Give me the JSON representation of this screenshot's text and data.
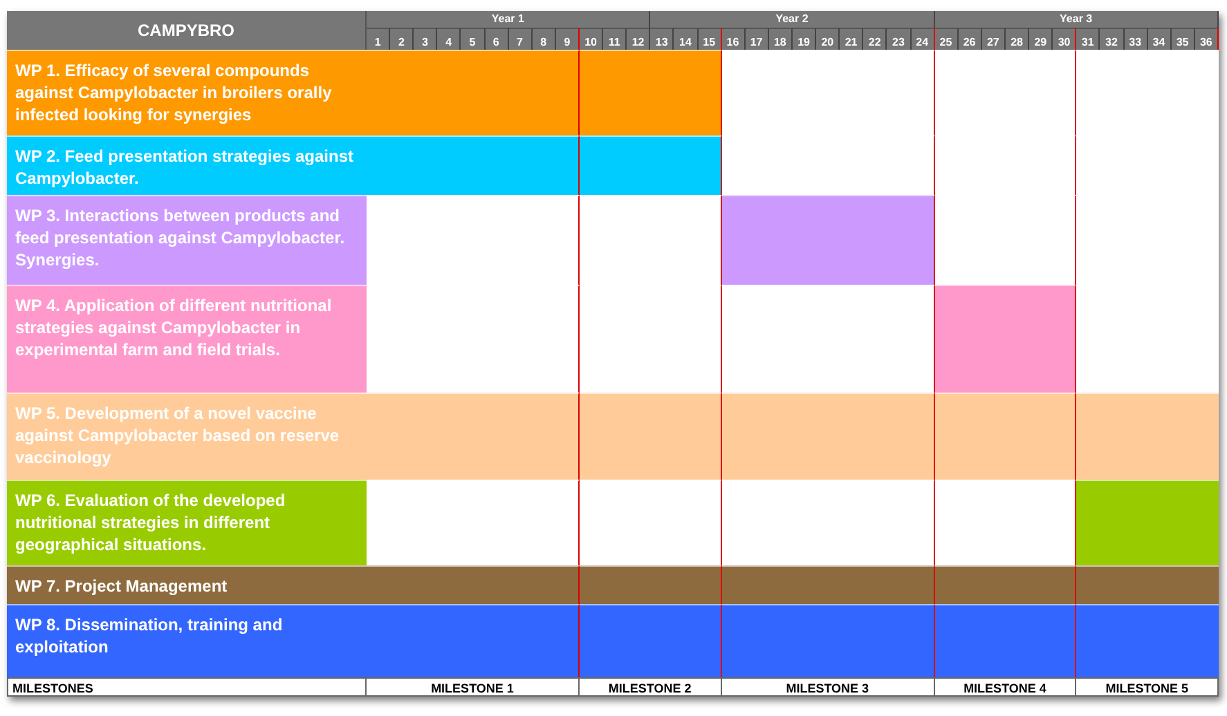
{
  "title": "CAMPYBRO",
  "years": [
    {
      "label": "Year 1",
      "months": [
        {
          "label": "1",
          "milestone_end": false
        },
        {
          "label": "2",
          "milestone_end": false
        },
        {
          "label": "3",
          "milestone_end": false
        },
        {
          "label": "4",
          "milestone_end": false
        },
        {
          "label": "5",
          "milestone_end": false
        },
        {
          "label": "6",
          "milestone_end": false
        },
        {
          "label": "7",
          "milestone_end": false
        },
        {
          "label": "8",
          "milestone_end": false
        },
        {
          "label": "9",
          "milestone_end": true
        },
        {
          "label": "10",
          "milestone_end": false
        },
        {
          "label": "11",
          "milestone_end": false
        },
        {
          "label": "12",
          "milestone_end": false
        }
      ]
    },
    {
      "label": "Year 2",
      "months": [
        {
          "label": "13",
          "milestone_end": false
        },
        {
          "label": "14",
          "milestone_end": false
        },
        {
          "label": "15",
          "milestone_end": true
        },
        {
          "label": "16",
          "milestone_end": false
        },
        {
          "label": "17",
          "milestone_end": false
        },
        {
          "label": "18",
          "milestone_end": false
        },
        {
          "label": "19",
          "milestone_end": false
        },
        {
          "label": "20",
          "milestone_end": false
        },
        {
          "label": "21",
          "milestone_end": false
        },
        {
          "label": "22",
          "milestone_end": false
        },
        {
          "label": "23",
          "milestone_end": false
        },
        {
          "label": "24",
          "milestone_end": true
        }
      ]
    },
    {
      "label": "Year 3",
      "months": [
        {
          "label": "25",
          "milestone_end": false
        },
        {
          "label": "26",
          "milestone_end": false
        },
        {
          "label": "27",
          "milestone_end": false
        },
        {
          "label": "28",
          "milestone_end": false
        },
        {
          "label": "29",
          "milestone_end": false
        },
        {
          "label": "30",
          "milestone_end": true
        },
        {
          "label": "31",
          "milestone_end": false
        },
        {
          "label": "32",
          "milestone_end": false
        },
        {
          "label": "33",
          "milestone_end": false
        },
        {
          "label": "34",
          "milestone_end": false
        },
        {
          "label": "35",
          "milestone_end": false
        },
        {
          "label": "36",
          "milestone_end": true
        }
      ]
    }
  ],
  "work_packages": [
    {
      "label": "WP 1. Efficacy of several compounds against Campylobacter in broilers orally infected looking for synergies",
      "color": "#ff9900",
      "periods": [
        true,
        true,
        false,
        false,
        false
      ]
    },
    {
      "label": "WP 2. Feed presentation strategies against Campylobacter.",
      "color": "#00ccff",
      "periods": [
        true,
        true,
        false,
        false,
        false
      ]
    },
    {
      "label": "WP 3. Interactions between products and feed presentation against Campylobacter. Synergies.",
      "color": "#cc99ff",
      "periods": [
        false,
        false,
        true,
        false,
        false
      ]
    },
    {
      "label": "WP 4. Application of different nutritional strategies against Campylobacter in experimental farm and field trials.",
      "color": "#ff99cc",
      "periods": [
        false,
        false,
        false,
        true,
        false
      ]
    },
    {
      "label": "WP 5. Development of a novel vaccine against Campylobacter based on reserve vaccinology",
      "color": "#ffcc99",
      "periods": [
        true,
        true,
        true,
        true,
        true
      ]
    },
    {
      "label": "WP 6. Evaluation of the developed nutritional strategies in different geographical situations.",
      "color": "#99cc00",
      "periods": [
        false,
        false,
        false,
        false,
        true
      ]
    },
    {
      "label": "WP 7. Project Management",
      "color": "#8e6b3e",
      "periods": [
        true,
        true,
        true,
        true,
        true
      ]
    },
    {
      "label": "WP 8. Dissemination, training and exploitation",
      "color": "#3366ff",
      "periods": [
        true,
        true,
        true,
        true,
        true
      ]
    }
  ],
  "milestones": {
    "label": "MILESTONES",
    "items": [
      "MILESTONE 1",
      "MILESTONE 2",
      "MILESTONE 3",
      "MILESTONE 4",
      "MILESTONE 5"
    ]
  }
}
